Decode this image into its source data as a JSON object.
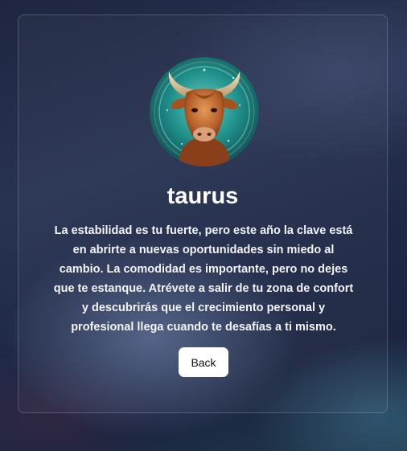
{
  "sign": {
    "name": "taurus",
    "image_icon": "taurus-bull-icon",
    "description": "La estabilidad es tu fuerte, pero este año la clave está en abrirte a nuevas oportunidades sin miedo al cambio. La comodidad es importante, pero no dejes que te estanque. Atrévete a salir de tu zona de confort y descubrirás que el crecimiento personal y profesional llega cuando te desafías a ti mismo."
  },
  "actions": {
    "back_label": "Back"
  },
  "colors": {
    "background": "#232c48",
    "card_border": "#5c6478",
    "button_bg": "#ffffff",
    "text": "#ffffff"
  }
}
